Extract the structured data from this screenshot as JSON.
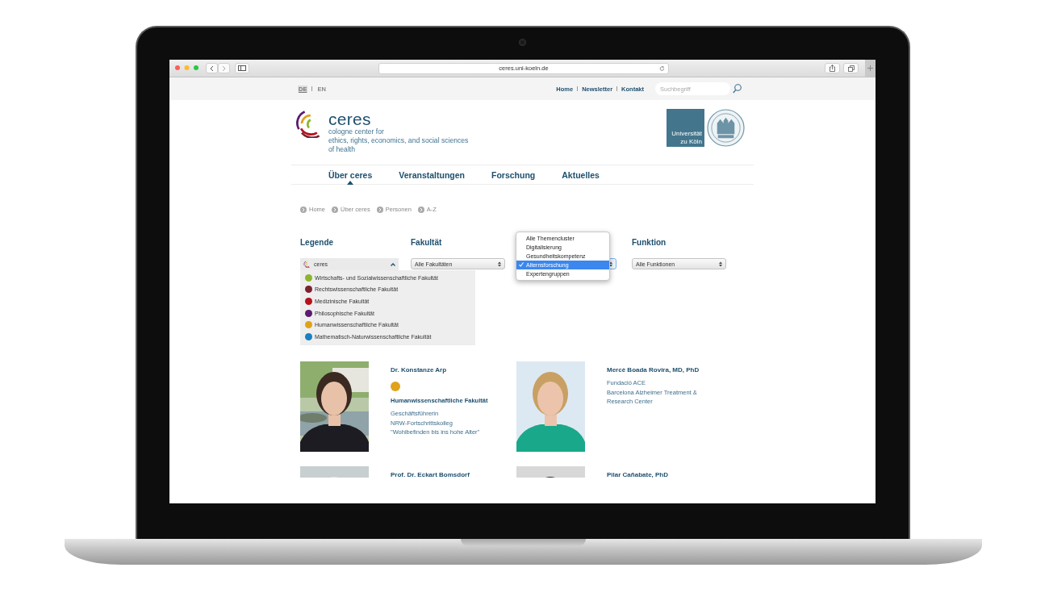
{
  "browser": {
    "url": "ceres.uni-koeln.de"
  },
  "top_bar": {
    "languages": [
      {
        "label": "DE",
        "selected": true
      },
      {
        "label": "EN",
        "selected": false
      }
    ],
    "links": [
      "Home",
      "Newsletter",
      "Kontakt"
    ],
    "search": {
      "placeholder": "Suchbegriff"
    }
  },
  "brand": {
    "name": "ceres",
    "tagline": [
      "cologne center for",
      "ethics, rights, economics, and social sciences",
      "of health"
    ],
    "university": [
      "Universität",
      "zu Köln"
    ]
  },
  "nav": [
    {
      "label": "Über ceres",
      "selected": true
    },
    {
      "label": "Veranstaltungen",
      "selected": false
    },
    {
      "label": "Forschung",
      "selected": false
    },
    {
      "label": "Aktuelles",
      "selected": false
    }
  ],
  "breadcrumbs": [
    "Home",
    "Über ceres",
    "Personen",
    "A-Z"
  ],
  "filters": {
    "legend": {
      "heading": "Legende",
      "value": "ceres",
      "expanded": true,
      "items": [
        {
          "label": "Wirtschafts- und Sozialwissenschaftliche Fakultät",
          "color": "#8db52e"
        },
        {
          "label": "Rechtswissenschaftliche Fakultät",
          "color": "#7c2030"
        },
        {
          "label": "Medizinische Fakultät",
          "color": "#b5121b"
        },
        {
          "label": "Philosophische Fakultät",
          "color": "#5b1a6f"
        },
        {
          "label": "Humanwissenschaftliche Fakultät",
          "color": "#e0a21a"
        },
        {
          "label": "Mathematisch-Naturwissenschaftliche Fakultät",
          "color": "#1a7fc4"
        }
      ]
    },
    "faculty": {
      "heading": "Fakultät",
      "value": "Alle Fakultäten"
    },
    "topic": {
      "options": [
        {
          "label": "Alle Themencluster",
          "selected": false
        },
        {
          "label": "Digitalisierung",
          "selected": false
        },
        {
          "label": "Gesundheitskompetenz",
          "selected": false
        },
        {
          "label": "Alternsforschung",
          "selected": true
        },
        {
          "label": "Expertengruppen",
          "selected": false
        }
      ]
    },
    "function": {
      "heading": "Funktion",
      "value": "Alle Funktionen"
    }
  },
  "people": [
    {
      "name": "Dr. Konstanze Arp",
      "color": "#e0a21a",
      "faculty": "Humanwissenschaftliche Fakultät",
      "details": [
        "Geschäftsführerin",
        "NRW-Fortschrittskolleg",
        "\"Wohlbefinden bis ins hohe Alter\""
      ]
    },
    {
      "name": "Mercè Boada Rovira, MD, PhD",
      "details": [
        "Fundació ACE",
        "Barcelona Alzheimer Treatment &",
        "Research Center"
      ]
    },
    {
      "name": "Prof. Dr. Eckart Bomsdorf"
    },
    {
      "name": "Pilar Cañabate, PhD"
    }
  ]
}
